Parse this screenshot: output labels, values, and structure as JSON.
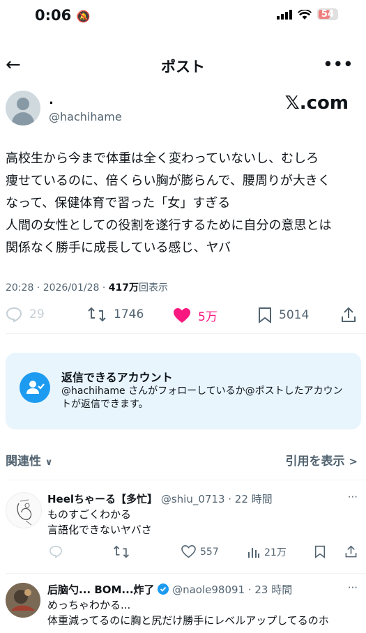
{
  "status_bar": {
    "time": "0:06",
    "battery": "54"
  },
  "nav": {
    "back_icon": "←",
    "title": "ポスト",
    "more_icon": "•••"
  },
  "post": {
    "display_name": ".",
    "handle": "@hachihame",
    "source_label": "𝕏.com",
    "lines": [
      "高校生から今まで体重は全く変わっていないし、むしろ",
      "痩せているのに、倍くらい胸が膨らんで、腰周りが大きく",
      "なって、保健体育で習った「女」すぎる",
      "人間の女性としての役割を遂行するために自分の意思とは",
      "関係なく勝手に成長している感じ、ヤバ"
    ],
    "time": "20:28 · 2026/01/28 · ",
    "views": "417万",
    "views_label": "回表示",
    "stats": {
      "replies": "29",
      "reposts": "1746",
      "likes": "5万",
      "bookmarks": "5014"
    }
  },
  "reply_restriction": {
    "title": "返信できるアカウント",
    "description": "@hachihame さんがフォローしているか@ポストしたアカウントが返信できます。"
  },
  "sort": {
    "label": "関連性",
    "quote_link": "引用を表示"
  },
  "replies": [
    {
      "name": "Heelちゃーる【多忙】",
      "handle_time": "@shiu_0713 · 22 時間",
      "lines": [
        "ものすごくわかる",
        "言語化できないヤバさ"
      ],
      "likes": "557",
      "views": "21万"
    },
    {
      "name": "后脑勺... BOM...炸了",
      "handle_time": "@naole98091 · 23 時間",
      "lines": [
        "めっちゃわかる...",
        "体重減ってるのに胸と尻だけ勝手にレベルアップしてるのホ"
      ]
    }
  ],
  "colors": {
    "like": "#f91880",
    "accent": "#1d9bf0",
    "secondary": "#536471",
    "reply_box": "#e8f5fd"
  }
}
